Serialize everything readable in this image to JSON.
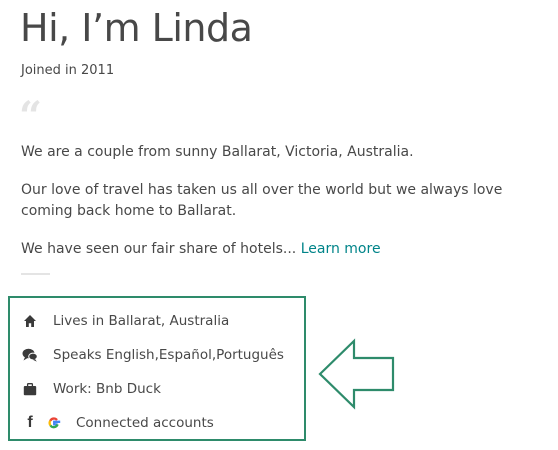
{
  "profile": {
    "greeting": "Hi, I’m Linda",
    "joined": "Joined in 2011"
  },
  "about": {
    "quote_glyph": "“",
    "paragraph1": "We are a couple from sunny Ballarat, Victoria, Australia.",
    "paragraph2": "Our love of travel has taken us all over the world but we always love coming back home to Ballarat.",
    "paragraph3": "We have seen our fair share of hotels...",
    "learn_more": "Learn more"
  },
  "details": {
    "lives": "Lives in Ballarat, Australia",
    "speaks": "Speaks English,Español,Português",
    "work": "Work: Bnb Duck",
    "connected": "Connected accounts",
    "facebook_glyph": "f"
  },
  "icons": {
    "lives": "home-icon",
    "speaks": "speech-bubble-icon",
    "work": "briefcase-icon",
    "facebook": "facebook-icon",
    "google": "google-icon"
  },
  "colors": {
    "text": "#484848",
    "link": "#008489",
    "annotation": "#2e8b6b"
  }
}
